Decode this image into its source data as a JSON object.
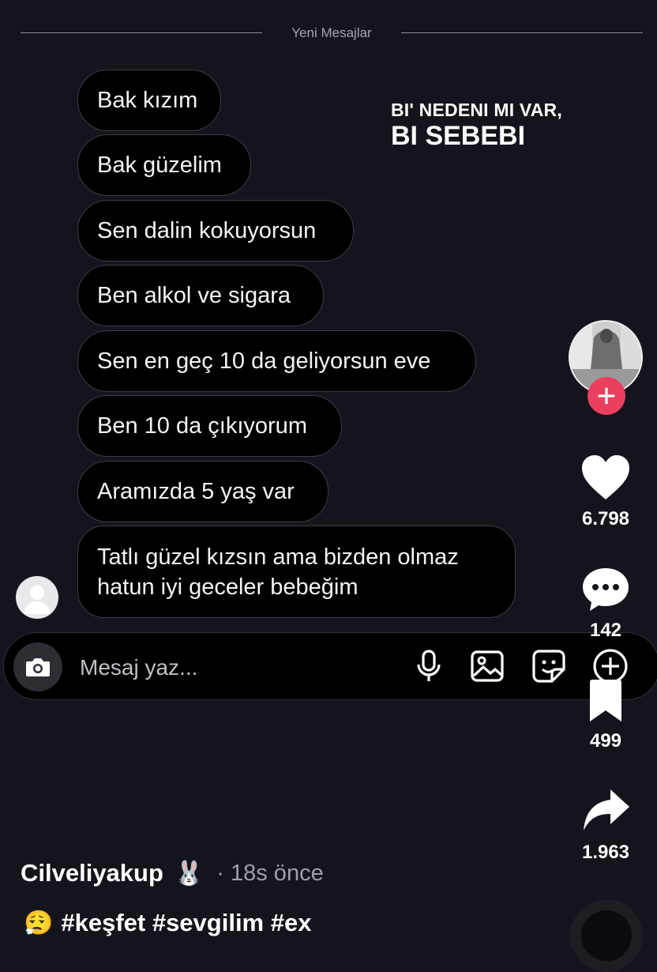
{
  "chat": {
    "divider_label": "Yeni Mesajlar",
    "messages": [
      {
        "text": "Bak kızım"
      },
      {
        "text": "Bak güzelim"
      },
      {
        "text": "Sen dalin kokuyorsun"
      },
      {
        "text": "Ben alkol ve sigara"
      },
      {
        "text": "Sen en geç 10 da geliyorsun eve"
      },
      {
        "text": "Ben 10 da çıkıyorum"
      },
      {
        "text": "Aramızda 5 yaş var"
      },
      {
        "line1": "Tatlı güzel kızsın ama bizden olmaz",
        "line2": "hatun iyi geceler bebeğim"
      }
    ]
  },
  "overlay": {
    "line1": "BI' NEDENI MI VAR,",
    "line2": "BI SEBEBI"
  },
  "composer": {
    "placeholder": "Mesaj yaz...",
    "icons": [
      "camera-icon",
      "microphone-icon",
      "image-icon",
      "sticker-icon",
      "add-icon"
    ]
  },
  "rail": {
    "likes": "6.798",
    "comments": "142",
    "saves": "499",
    "shares": "1.963",
    "icons": [
      "follow-plus-icon",
      "heart-icon",
      "comment-icon",
      "bookmark-icon",
      "share-icon"
    ]
  },
  "post": {
    "author": "Cilveliyakup",
    "author_emoji": "🐰",
    "time": "· 18s önce",
    "caption_emoji": "😮‍💨",
    "hashtags": "#keşfet #sevgilim #ex"
  },
  "colors": {
    "background": "#14151c",
    "bubble": "#000000",
    "bubble_border": "#3c3d44",
    "follow_button": "#ea3f5f"
  }
}
